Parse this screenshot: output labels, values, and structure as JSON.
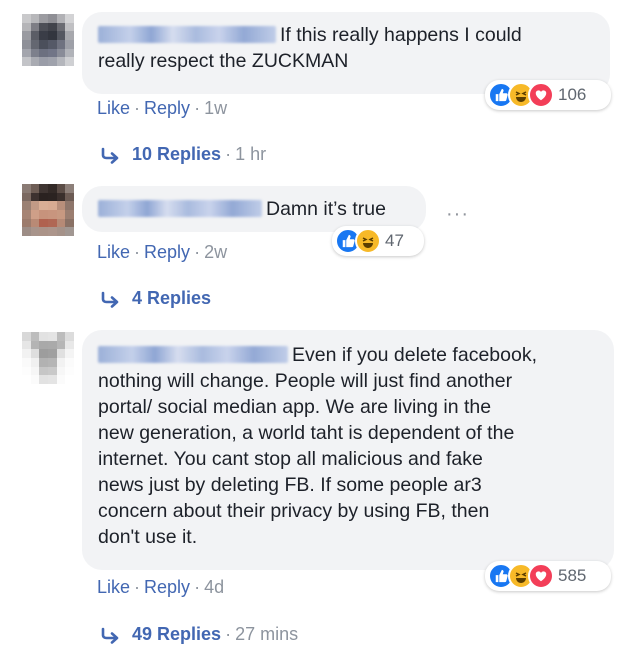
{
  "comments": [
    {
      "text": "If this really happens I could really respect the ZUCKMAN",
      "text_line1": "If this really happens I could",
      "text_line2": "really respect the ZUCKMAN",
      "like_label": "Like",
      "reply_label": "Reply",
      "age": "1w",
      "reaction_count": "106",
      "reactions": [
        "like-icon",
        "haha-icon",
        "love-icon"
      ],
      "replies_label": "10 Replies",
      "replies_time": "1 hr"
    },
    {
      "text": "Damn it’s true",
      "like_label": "Like",
      "reply_label": "Reply",
      "age": "2w",
      "reaction_count": "47",
      "reactions": [
        "like-icon",
        "haha-icon"
      ],
      "more_label": "···",
      "replies_label": "4 Replies",
      "replies_time": ""
    },
    {
      "text_lines": [
        "Even if you delete facebook,",
        "nothing will change. People will just find another",
        "portal/ social median app. We are living in the",
        "new generation, a world taht is dependent of the",
        "internet. You cant stop all malicious and fake",
        "news just by deleting FB. If some people ar3",
        "concern about their privacy by using FB, then",
        "don't use it."
      ],
      "like_label": "Like",
      "reply_label": "Reply",
      "age": "4d",
      "reaction_count": "585",
      "reactions": [
        "like-icon",
        "haha-icon",
        "love-icon"
      ],
      "replies_label": "49 Replies",
      "replies_time": "27 mins"
    }
  ],
  "separator": "·",
  "colors": {
    "link": "#4267b2",
    "meta": "#8d949e",
    "bubble": "#f2f3f5",
    "like": "#1877f2",
    "haha": "#f7b928",
    "love": "#f33e58"
  }
}
